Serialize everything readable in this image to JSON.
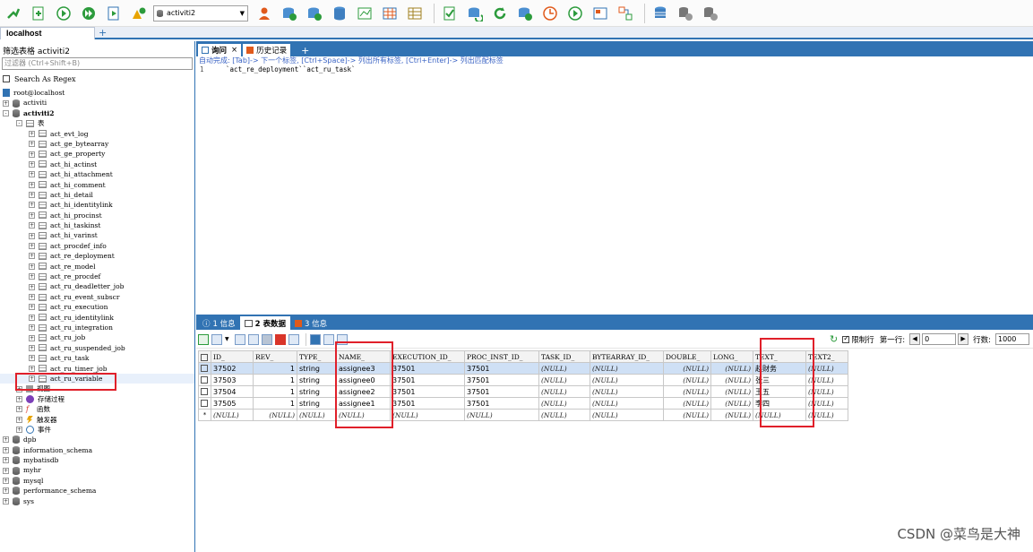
{
  "toolbar": {
    "database_select": "activiti2"
  },
  "connection_tabs": {
    "active": "localhost",
    "add": "+"
  },
  "left_panel": {
    "filter_title": "筛选表格 activiti2",
    "filter_placeholder": "过滤器 (Ctrl+Shift+B)",
    "search_regex": "Search As Regex",
    "root": "root@localhost",
    "databases_top": [
      "activiti",
      "activiti2"
    ],
    "tables_folder": "表",
    "tables": [
      "act_evt_log",
      "act_ge_bytearray",
      "act_ge_property",
      "act_hi_actinst",
      "act_hi_attachment",
      "act_hi_comment",
      "act_hi_detail",
      "act_hi_identitylink",
      "act_hi_procinst",
      "act_hi_taskinst",
      "act_hi_varinst",
      "act_procdef_info",
      "act_re_deployment",
      "act_re_model",
      "act_re_procdef",
      "act_ru_deadletter_job",
      "act_ru_event_subscr",
      "act_ru_execution",
      "act_ru_identitylink",
      "act_ru_integration",
      "act_ru_job",
      "act_ru_suspended_job",
      "act_ru_task",
      "act_ru_timer_job",
      "act_ru_variable"
    ],
    "folders": [
      "视图",
      "存储过程",
      "函数",
      "触发器",
      "事件"
    ],
    "databases_bottom": [
      "dpb",
      "information_schema",
      "mybatisdb",
      "myhr",
      "mysql",
      "performance_schema",
      "sys"
    ]
  },
  "query_tabs": {
    "query": "询问",
    "close": "×",
    "history": "历史记录",
    "add": "+"
  },
  "hint": "自动完成: [Tab]-> 下一个标签, [Ctrl+Space]-> 列出所有标签, [Ctrl+Enter]-> 列出匹配标签",
  "sql": {
    "line_no": "1",
    "text": "`act_re_deployment``act_ru_task`"
  },
  "result_tabs": [
    "1 信息",
    "2 表数据",
    "3 信息"
  ],
  "result_toolbar": {
    "limit_label": "限制行",
    "first_row_label": "第一行:",
    "first_row_value": "0",
    "rows_label": "行数:",
    "rows_value": "1000"
  },
  "grid": {
    "columns": [
      "ID_",
      "REV_",
      "TYPE_",
      "NAME_",
      "EXECUTION_ID_",
      "PROC_INST_ID_",
      "TASK_ID_",
      "BYTEARRAY_ID_",
      "DOUBLE_",
      "LONG_",
      "TEXT_",
      "TEXT2_"
    ],
    "rows": [
      [
        "37502",
        "1",
        "string",
        "assignee3",
        "37501",
        "37501",
        "(NULL)",
        "(NULL)",
        "(NULL)",
        "(NULL)",
        "赵财务",
        "(NULL)"
      ],
      [
        "37503",
        "1",
        "string",
        "assignee0",
        "37501",
        "37501",
        "(NULL)",
        "(NULL)",
        "(NULL)",
        "(NULL)",
        "张三",
        "(NULL)"
      ],
      [
        "37504",
        "1",
        "string",
        "assignee2",
        "37501",
        "37501",
        "(NULL)",
        "(NULL)",
        "(NULL)",
        "(NULL)",
        "王五",
        "(NULL)"
      ],
      [
        "37505",
        "1",
        "string",
        "assignee1",
        "37501",
        "37501",
        "(NULL)",
        "(NULL)",
        "(NULL)",
        "(NULL)",
        "李四",
        "(NULL)"
      ],
      [
        "(NULL)",
        "(NULL)",
        "(NULL)",
        "(NULL)",
        "(NULL)",
        "(NULL)",
        "(NULL)",
        "(NULL)",
        "(NULL)",
        "(NULL)",
        "(NULL)",
        "(NULL)"
      ]
    ],
    "new_row_marker": "*"
  },
  "watermark": "CSDN @菜鸟是大神",
  "colors": {
    "accent": "#3173b3",
    "highlight": "#e0202a"
  }
}
